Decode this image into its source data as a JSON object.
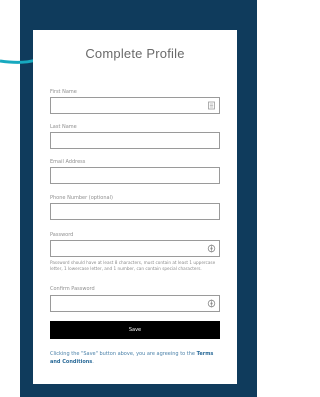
{
  "form": {
    "title": "Complete Profile",
    "fields": [
      {
        "label": "First Name",
        "value": ""
      },
      {
        "label": "Last Name",
        "value": ""
      },
      {
        "label": "Email Address",
        "value": ""
      },
      {
        "label": "Phone Number (optional)",
        "value": ""
      },
      {
        "label": "Password",
        "value": ""
      },
      {
        "label": "Confirm Password",
        "value": ""
      }
    ],
    "password_hint": "Password should have at least 8 characters, must contain at least 1 uppercase letter, 1 lowercase letter, and 1 number, can contain special characters.",
    "save_label": "Save",
    "agreement_prefix": "Clicking the \"Save\" button above, you are agreeing to the ",
    "agreement_link": "Terms and Conditions",
    "agreement_suffix": "."
  },
  "icons": {
    "first_name_field": "contact-card-icon",
    "password_field": "eye-icon",
    "confirm_password_field": "eye-icon",
    "pointer": "arrow-right-icon"
  },
  "colors": {
    "background": "#0f3b5c",
    "arrow": "#17a9bf",
    "save_button": "#000000",
    "link": "#2a6a98"
  }
}
